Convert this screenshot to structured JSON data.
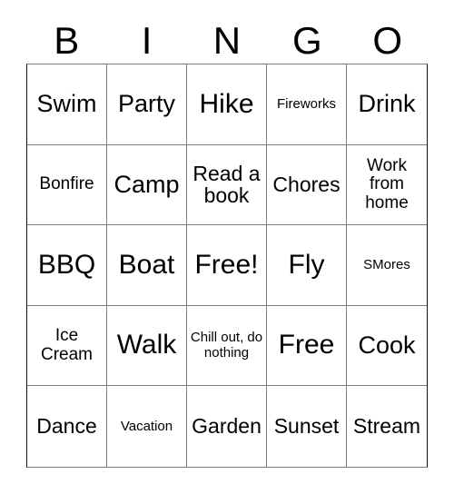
{
  "card": {
    "header_letters": [
      "B",
      "I",
      "N",
      "G",
      "O"
    ],
    "rows": [
      [
        {
          "text": "Swim",
          "size": "lg"
        },
        {
          "text": "Party",
          "size": "lg"
        },
        {
          "text": "Hike",
          "size": "xl"
        },
        {
          "text": "Fireworks",
          "size": "xs"
        },
        {
          "text": "Drink",
          "size": "lg"
        }
      ],
      [
        {
          "text": "Bonfire",
          "size": "sm"
        },
        {
          "text": "Camp",
          "size": "lg"
        },
        {
          "text": "Read a book",
          "size": "md"
        },
        {
          "text": "Chores",
          "size": "md"
        },
        {
          "text": "Work from home",
          "size": "sm"
        }
      ],
      [
        {
          "text": "BBQ",
          "size": "xl"
        },
        {
          "text": "Boat",
          "size": "xl"
        },
        {
          "text": "Free!",
          "size": "xl"
        },
        {
          "text": "Fly",
          "size": "xl"
        },
        {
          "text": "SMores",
          "size": "xs"
        }
      ],
      [
        {
          "text": "Ice Cream",
          "size": "sm"
        },
        {
          "text": "Walk",
          "size": "xl"
        },
        {
          "text": "Chill out, do nothing",
          "size": "xs"
        },
        {
          "text": "Free",
          "size": "xl"
        },
        {
          "text": "Cook",
          "size": "lg"
        }
      ],
      [
        {
          "text": "Dance",
          "size": "md"
        },
        {
          "text": "Vacation",
          "size": "xs"
        },
        {
          "text": "Garden",
          "size": "md"
        },
        {
          "text": "Sunset",
          "size": "md"
        },
        {
          "text": "Stream",
          "size": "md"
        }
      ]
    ]
  },
  "colors": {
    "background": "#ffffff",
    "text": "#000000",
    "grid_line": "#7b7b7b",
    "grid_outer": "#111111"
  }
}
